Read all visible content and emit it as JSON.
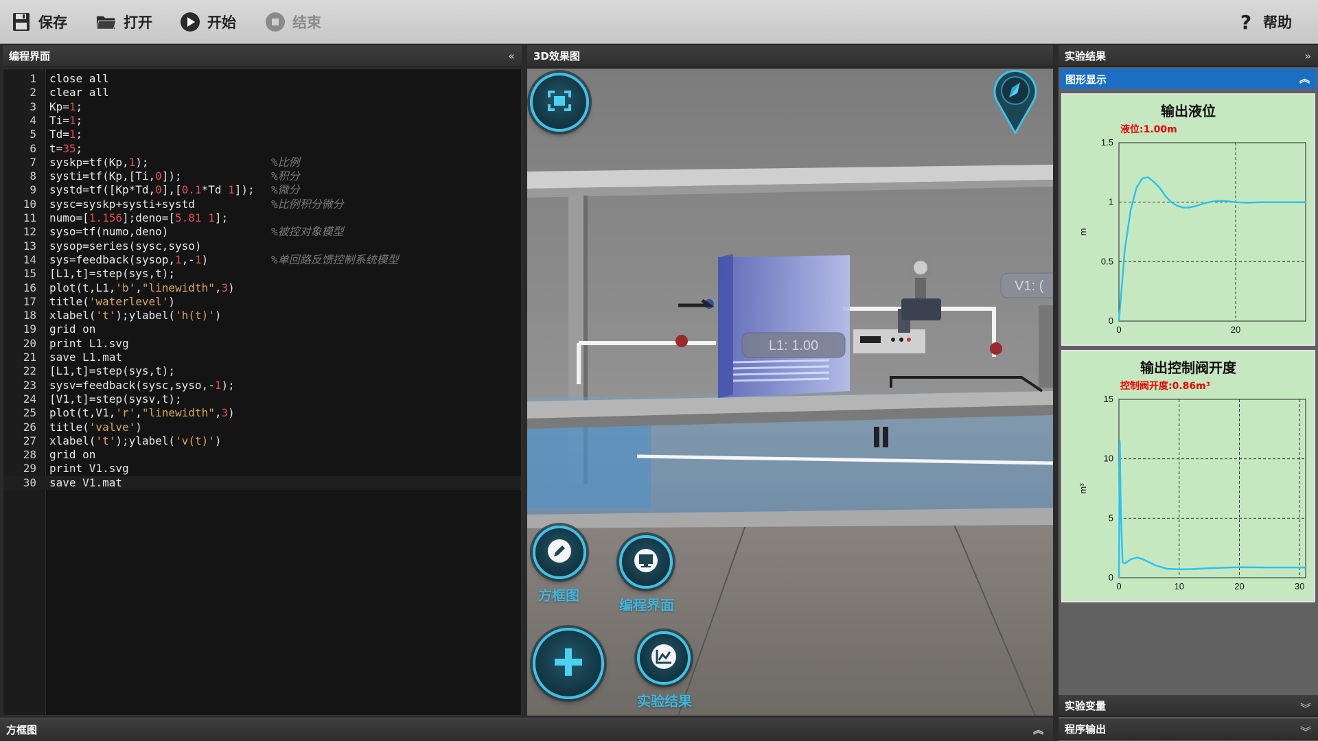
{
  "toolbar": {
    "save": "保存",
    "open": "打开",
    "start": "开始",
    "stop": "结束",
    "help": "帮助"
  },
  "code_panel": {
    "title": "编程界面",
    "lines": [
      "close all",
      "clear all",
      "Kp=1;",
      "Ti=1;",
      "Td=1;",
      "t=35;",
      "syskp=tf(Kp,1);",
      "systi=tf(Kp,[Ti,0]);",
      "systd=tf([Kp*Td,0],[0.1*Td 1]);",
      "sysc=syskp+systi+systd",
      "numo=[1.156];deno=[5.81 1];",
      "syso=tf(numo,deno)",
      "sysop=series(sysc,syso)",
      "sys=feedback(sysop,1,-1)",
      "[L1,t]=step(sys,t);",
      "plot(t,L1,'b',\"linewidth\",3)",
      "title('waterlevel')",
      "xlabel('t');ylabel('h(t)')",
      "grid on",
      "print L1.svg",
      "save L1.mat",
      "[L1,t]=step(sys,t);",
      "sysv=feedback(sysc,syso,-1);",
      "[V1,t]=step(sysv,t);",
      "plot(t,V1,'r',\"linewidth\",3)",
      "title('valve')",
      "xlabel('t');ylabel('v(t)')",
      "grid on",
      "print V1.svg",
      "save V1.mat"
    ],
    "comments": {
      "7": "%比例",
      "8": "%积分",
      "9": "%微分",
      "10": "%比例积分微分",
      "12": "%被控对象模型",
      "14": "%单回路反馈控制系统模型"
    }
  },
  "view_panel": {
    "title": "3D效果图",
    "tank_label": "L1: 1.00",
    "valve_label": "V1: (",
    "btn_block": "方框图",
    "btn_code": "编程界面",
    "btn_result": "实验结果"
  },
  "right_panel": {
    "title": "实验结果",
    "graph_section": "图形显示",
    "variables": "实验变量",
    "output": "程序输出"
  },
  "bottom_panel": {
    "title": "方框图"
  },
  "chart_data": [
    {
      "type": "line",
      "title": "输出液位",
      "subtitle": "液位:1.00m",
      "ylabel": "m",
      "xlabel": "",
      "xlim": [
        0,
        32
      ],
      "ylim": [
        0,
        1.5
      ],
      "x_ticks": [
        0,
        20
      ],
      "y_ticks": [
        0,
        0.5,
        1,
        1.5
      ],
      "grid": true,
      "color": "#29c3f0",
      "x": [
        0,
        0.5,
        1,
        2,
        3,
        4,
        5,
        6,
        7,
        8,
        9,
        10,
        11,
        12,
        13,
        14,
        15,
        16,
        17,
        18,
        19,
        20,
        22,
        24,
        26,
        28,
        30,
        32
      ],
      "y": [
        0,
        0.3,
        0.6,
        0.93,
        1.12,
        1.2,
        1.21,
        1.17,
        1.12,
        1.05,
        1.0,
        0.97,
        0.955,
        0.955,
        0.965,
        0.98,
        0.995,
        1.005,
        1.01,
        1.01,
        1.005,
        1.0,
        0.995,
        1.0,
        1.0,
        1.0,
        1.0,
        1.0
      ]
    },
    {
      "type": "line",
      "title": "输出控制阀开度",
      "subtitle": "控制阀开度:0.86m³",
      "ylabel": "m³",
      "xlabel": "",
      "xlim": [
        0,
        31
      ],
      "ylim": [
        0,
        15
      ],
      "x_ticks": [
        0,
        10,
        20,
        30
      ],
      "y_ticks": [
        0,
        5,
        10,
        15
      ],
      "grid": true,
      "color": "#29c3f0",
      "x": [
        0,
        0.15,
        0.3,
        0.6,
        1,
        2,
        3,
        4,
        5,
        6,
        7,
        8,
        10,
        12,
        15,
        18,
        20,
        22,
        25,
        28,
        31
      ],
      "y": [
        0,
        11.5,
        6,
        1.3,
        1.2,
        1.55,
        1.7,
        1.55,
        1.3,
        1.05,
        0.9,
        0.75,
        0.7,
        0.72,
        0.8,
        0.85,
        0.88,
        0.87,
        0.86,
        0.86,
        0.86
      ]
    }
  ]
}
